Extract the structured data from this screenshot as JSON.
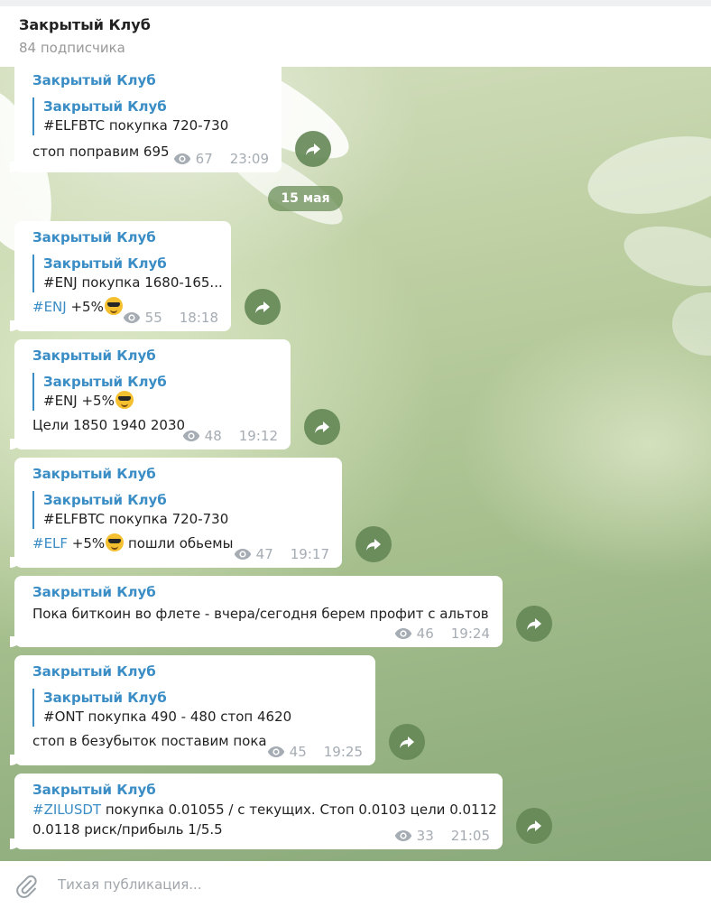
{
  "channel": {
    "title": "Закрытый Клуб",
    "subtitle": "84 подписчика"
  },
  "date_separator": "15 мая",
  "messages": [
    {
      "sender": "Закрытый Клуб",
      "quote_sender": "Закрытый Клуб",
      "quote_text": "#ELFBTC покупка 720-730",
      "text": "стоп поправим 695",
      "views": "67",
      "time": "23:09"
    },
    {
      "sender": "Закрытый Клуб",
      "quote_sender": "Закрытый Клуб",
      "quote_text": "#ENJ покупка 1680-165...",
      "hashtag": "#ENJ",
      "text": " +5%",
      "views": "55",
      "time": "18:18"
    },
    {
      "sender": "Закрытый Клуб",
      "quote_sender": "Закрытый Клуб",
      "quote_text": "#ENJ +5%",
      "text": "Цели 1850 1940 2030",
      "views": "48",
      "time": "19:12"
    },
    {
      "sender": "Закрытый Клуб",
      "quote_sender": "Закрытый Клуб",
      "quote_text": "#ELFBTC покупка 720-730",
      "hashtag": "#ELF",
      "text": " +5%",
      "text_after_emoji": " пошли обьемы",
      "views": "47",
      "time": "19:17"
    },
    {
      "sender": "Закрытый Клуб",
      "text": "Пока биткоин во флете - вчера/сегодня берем профит с альтов",
      "views": "46",
      "time": "19:24"
    },
    {
      "sender": "Закрытый Клуб",
      "quote_sender": "Закрытый Клуб",
      "quote_text": "#ONT покупка 490 - 480 стоп 4620",
      "text": "стоп в безубыток поставим пока",
      "views": "45",
      "time": "19:25"
    },
    {
      "sender": "Закрытый Клуб",
      "hashtag": "#ZILUSDT",
      "text": " покупка 0.01055 / с текущих. Стоп 0.0103 цели 0.0112",
      "text_line2": "0.0118 риск/прибыль 1/5.5",
      "views": "33",
      "time": "21:05"
    }
  ],
  "composer": {
    "placeholder": "Тихая публикация..."
  },
  "icons": {
    "views": "eye-icon",
    "forward": "share-arrow-icon",
    "attach": "paperclip-icon",
    "emoji": "sunglasses-face-emoji"
  },
  "colors": {
    "link": "#3a8dc5",
    "meta": "#a5acb3",
    "forward_button": "#648755",
    "date_chip": "#6b8e58"
  }
}
